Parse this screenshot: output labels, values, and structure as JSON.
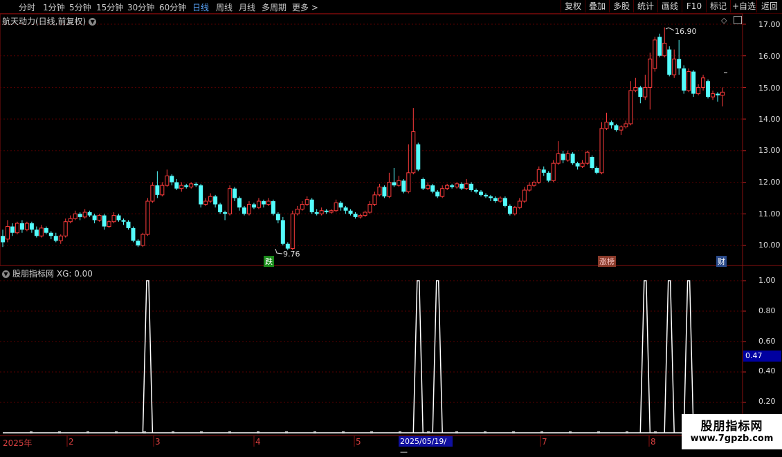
{
  "toolbar": {
    "left_tabs": [
      "分时",
      "1分钟",
      "5分钟",
      "15分钟",
      "30分钟",
      "60分钟",
      "日线",
      "周线",
      "月线",
      "多周期",
      "更多 >"
    ],
    "active_tab": "日线",
    "right_buttons": [
      "复权",
      "叠加",
      "多股",
      "统计",
      "画线",
      "F10",
      "标记",
      "+自选",
      "返回"
    ]
  },
  "main_chart": {
    "title": "航天动力(日线,前复权)",
    "y_ticks": [
      "17.00",
      "16.00",
      "15.00",
      "14.00",
      "13.00",
      "12.00",
      "11.00",
      "10.00"
    ],
    "high_label": "16.90",
    "low_label": "9.76",
    "badges": {
      "die": "跌",
      "zhangbang": "涨榜",
      "cai": "财"
    },
    "colors": {
      "up": "#ff3c3c",
      "down": "#54fcfc"
    }
  },
  "indicator": {
    "title": "股朋指标网",
    "value_text": "XG: 0.00",
    "y_ticks": [
      "1.00",
      "0.80",
      "0.60",
      "0.40",
      "0.20"
    ],
    "current_value": "0.47"
  },
  "date_axis": {
    "labels": [
      "2025年",
      "2",
      "3",
      "4",
      "5",
      "7",
      "8"
    ],
    "cursor_date": "2025/05/19/—"
  },
  "watermark": {
    "line1": "股朋指标网",
    "line2": "www.7gpzb.com"
  },
  "chart_data": {
    "type": "candlestick",
    "title": "航天动力(日线,前复权)",
    "ylim": [
      9.6,
      17.4
    ],
    "candles": [
      [
        10.3,
        10.1,
        10.5,
        9.95
      ],
      [
        10.2,
        10.6,
        10.8,
        10.1
      ],
      [
        10.6,
        10.4,
        10.7,
        10.3
      ],
      [
        10.4,
        10.7,
        10.75,
        10.35
      ],
      [
        10.7,
        10.5,
        10.8,
        10.4
      ],
      [
        10.5,
        10.7,
        10.75,
        10.45
      ],
      [
        10.7,
        10.5,
        10.75,
        10.4
      ],
      [
        10.5,
        10.3,
        10.6,
        10.25
      ],
      [
        10.3,
        10.55,
        10.65,
        10.25
      ],
      [
        10.55,
        10.4,
        10.6,
        10.35
      ],
      [
        10.4,
        10.3,
        10.45,
        10.2
      ],
      [
        10.3,
        10.15,
        10.4,
        10.1
      ],
      [
        10.15,
        10.3,
        10.35,
        10.05
      ],
      [
        10.3,
        10.75,
        10.85,
        10.25
      ],
      [
        10.75,
        10.85,
        10.95,
        10.7
      ],
      [
        10.85,
        11.0,
        11.1,
        10.8
      ],
      [
        11.0,
        10.9,
        11.05,
        10.8
      ],
      [
        10.9,
        11.05,
        11.15,
        10.85
      ],
      [
        11.05,
        10.95,
        11.1,
        10.9
      ],
      [
        10.95,
        10.8,
        11.0,
        10.7
      ],
      [
        10.8,
        10.95,
        11.0,
        10.75
      ],
      [
        10.95,
        10.6,
        11.0,
        10.5
      ],
      [
        10.6,
        10.75,
        10.8,
        10.55
      ],
      [
        10.75,
        10.95,
        11.05,
        10.7
      ],
      [
        10.95,
        10.8,
        11.0,
        10.75
      ],
      [
        10.8,
        10.75,
        10.85,
        10.65
      ],
      [
        10.75,
        10.55,
        10.8,
        10.5
      ],
      [
        10.55,
        10.15,
        10.6,
        10.1
      ],
      [
        10.15,
        10.0,
        10.2,
        9.95
      ],
      [
        10.0,
        10.35,
        10.4,
        9.95
      ],
      [
        10.35,
        11.4,
        11.5,
        10.3
      ],
      [
        11.4,
        11.9,
        12.0,
        11.35
      ],
      [
        11.9,
        11.6,
        12.35,
        11.5
      ],
      [
        11.6,
        11.9,
        12.0,
        11.55
      ],
      [
        11.9,
        12.2,
        12.4,
        11.85
      ],
      [
        12.2,
        12.0,
        12.25,
        11.9
      ],
      [
        12.0,
        11.8,
        12.1,
        11.75
      ],
      [
        11.8,
        11.9,
        12.0,
        11.7
      ],
      [
        11.9,
        11.85,
        11.95,
        11.8
      ],
      [
        11.85,
        11.95,
        12.0,
        11.8
      ],
      [
        11.95,
        11.9,
        12.0,
        11.85
      ],
      [
        11.9,
        11.3,
        11.95,
        11.2
      ],
      [
        11.3,
        11.4,
        11.5,
        11.25
      ],
      [
        11.4,
        11.55,
        11.65,
        11.35
      ],
      [
        11.55,
        11.3,
        11.6,
        11.2
      ],
      [
        11.3,
        11.05,
        11.35,
        11.0
      ],
      [
        11.05,
        11.0,
        11.1,
        10.8
      ],
      [
        11.0,
        11.8,
        11.9,
        10.95
      ],
      [
        11.8,
        11.5,
        11.85,
        11.4
      ],
      [
        11.5,
        11.2,
        11.55,
        11.1
      ],
      [
        11.2,
        11.0,
        11.25,
        10.95
      ],
      [
        11.0,
        11.3,
        11.4,
        10.95
      ],
      [
        11.3,
        11.2,
        11.35,
        11.15
      ],
      [
        11.2,
        11.4,
        11.5,
        11.15
      ],
      [
        11.4,
        11.3,
        11.45,
        11.2
      ],
      [
        11.3,
        11.4,
        11.5,
        11.25
      ],
      [
        11.4,
        11.0,
        11.45,
        10.95
      ],
      [
        11.0,
        10.8,
        11.05,
        10.7
      ],
      [
        10.8,
        10.05,
        10.9,
        10.0
      ],
      [
        10.05,
        9.9,
        10.1,
        9.85
      ],
      [
        9.9,
        11.0,
        11.1,
        9.85
      ],
      [
        11.0,
        11.15,
        11.25,
        10.95
      ],
      [
        11.15,
        11.3,
        11.4,
        11.1
      ],
      [
        11.3,
        11.45,
        11.55,
        11.25
      ],
      [
        11.45,
        11.05,
        11.5,
        11.0
      ],
      [
        11.05,
        11.0,
        11.15,
        10.95
      ],
      [
        11.0,
        11.1,
        11.2,
        10.95
      ],
      [
        11.1,
        11.05,
        11.15,
        11.0
      ],
      [
        11.05,
        11.1,
        11.15,
        11.0
      ],
      [
        11.1,
        11.35,
        11.45,
        11.05
      ],
      [
        11.35,
        11.2,
        11.4,
        11.1
      ],
      [
        11.2,
        11.1,
        11.25,
        11.0
      ],
      [
        11.1,
        11.0,
        11.15,
        10.95
      ],
      [
        11.0,
        10.9,
        11.05,
        10.85
      ],
      [
        10.9,
        10.95,
        11.0,
        10.85
      ],
      [
        10.95,
        11.05,
        11.1,
        10.9
      ],
      [
        11.05,
        11.3,
        11.4,
        11.0
      ],
      [
        11.3,
        11.6,
        11.7,
        11.25
      ],
      [
        11.6,
        11.85,
        11.95,
        11.55
      ],
      [
        11.85,
        11.55,
        11.9,
        11.5
      ],
      [
        11.55,
        12.0,
        12.3,
        11.5
      ],
      [
        12.0,
        11.9,
        12.45,
        11.85
      ],
      [
        11.9,
        12.05,
        12.2,
        11.85
      ],
      [
        12.05,
        11.7,
        12.1,
        11.65
      ],
      [
        11.7,
        12.3,
        13.2,
        11.65
      ],
      [
        12.3,
        13.6,
        14.35,
        12.25
      ],
      [
        13.2,
        12.4,
        13.25,
        12.35
      ],
      [
        12.1,
        11.8,
        12.15,
        11.75
      ],
      [
        11.8,
        11.9,
        12.0,
        11.75
      ],
      [
        11.9,
        11.7,
        11.95,
        11.65
      ],
      [
        11.7,
        11.55,
        11.75,
        11.5
      ],
      [
        11.55,
        11.8,
        11.9,
        11.5
      ],
      [
        11.8,
        11.9,
        11.95,
        11.75
      ],
      [
        11.9,
        11.85,
        11.95,
        11.8
      ],
      [
        11.85,
        11.95,
        12.0,
        11.8
      ],
      [
        11.95,
        11.8,
        12.0,
        11.75
      ],
      [
        11.8,
        11.95,
        12.1,
        11.75
      ],
      [
        11.95,
        11.75,
        12.0,
        11.7
      ],
      [
        11.75,
        11.7,
        11.8,
        11.65
      ],
      [
        11.7,
        11.6,
        11.75,
        11.55
      ],
      [
        11.6,
        11.55,
        11.65,
        11.5
      ],
      [
        11.55,
        11.5,
        11.6,
        11.4
      ],
      [
        11.5,
        11.4,
        11.55,
        11.35
      ],
      [
        11.4,
        11.5,
        11.55,
        11.35
      ],
      [
        11.5,
        11.25,
        11.55,
        11.2
      ],
      [
        11.25,
        11.0,
        11.3,
        10.95
      ],
      [
        11.0,
        11.2,
        11.25,
        10.95
      ],
      [
        11.2,
        11.4,
        11.5,
        11.15
      ],
      [
        11.4,
        11.75,
        11.85,
        11.35
      ],
      [
        11.75,
        11.9,
        12.0,
        11.7
      ],
      [
        11.9,
        12.0,
        12.05,
        11.85
      ],
      [
        12.0,
        12.4,
        12.5,
        11.95
      ],
      [
        12.4,
        12.3,
        12.5,
        12.2
      ],
      [
        12.3,
        12.05,
        12.35,
        12.0
      ],
      [
        12.05,
        12.6,
        12.7,
        12.0
      ],
      [
        12.6,
        12.9,
        13.3,
        12.55
      ],
      [
        12.9,
        12.7,
        13.0,
        12.6
      ],
      [
        12.7,
        12.9,
        13.0,
        12.65
      ],
      [
        12.9,
        12.6,
        12.95,
        12.55
      ],
      [
        12.6,
        12.5,
        12.65,
        12.4
      ],
      [
        12.5,
        12.6,
        12.7,
        12.45
      ],
      [
        12.6,
        12.95,
        13.0,
        12.55
      ],
      [
        12.8,
        12.45,
        12.85,
        12.4
      ],
      [
        12.45,
        12.3,
        12.5,
        12.25
      ],
      [
        12.3,
        13.7,
        13.9,
        12.25
      ],
      [
        13.7,
        13.9,
        14.2,
        13.65
      ],
      [
        13.9,
        13.8,
        13.95,
        13.7
      ],
      [
        13.8,
        13.65,
        13.85,
        13.6
      ],
      [
        13.65,
        13.75,
        13.8,
        13.5
      ],
      [
        13.75,
        13.85,
        13.95,
        13.7
      ],
      [
        13.85,
        14.9,
        15.2,
        13.8
      ],
      [
        14.9,
        15.0,
        15.3,
        14.85
      ],
      [
        15.0,
        14.7,
        15.05,
        14.5
      ],
      [
        14.7,
        15.0,
        15.4,
        14.6
      ],
      [
        15.0,
        15.9,
        16.1,
        14.3
      ],
      [
        15.6,
        16.5,
        16.6,
        15.5
      ],
      [
        16.6,
        16.0,
        16.7,
        15.95
      ],
      [
        16.0,
        16.4,
        16.9,
        15.95
      ],
      [
        16.2,
        15.4,
        16.3,
        15.35
      ],
      [
        15.4,
        15.9,
        16.2,
        15.3
      ],
      [
        15.9,
        15.6,
        16.5,
        15.4
      ],
      [
        15.6,
        14.9,
        15.7,
        14.8
      ],
      [
        14.9,
        15.5,
        15.6,
        14.85
      ],
      [
        15.5,
        14.8,
        15.55,
        14.7
      ],
      [
        14.8,
        15.0,
        15.1,
        14.75
      ],
      [
        15.0,
        15.3,
        15.4,
        14.9
      ],
      [
        15.2,
        14.7,
        15.25,
        14.65
      ],
      [
        14.7,
        14.8,
        14.9,
        14.6
      ],
      [
        14.8,
        14.75,
        14.85,
        14.55
      ],
      [
        14.75,
        14.85,
        15.0,
        14.4
      ]
    ],
    "indicator_series": {
      "name": "XG",
      "spikes_at_index": [
        30,
        86,
        90,
        133,
        138,
        142
      ]
    }
  }
}
